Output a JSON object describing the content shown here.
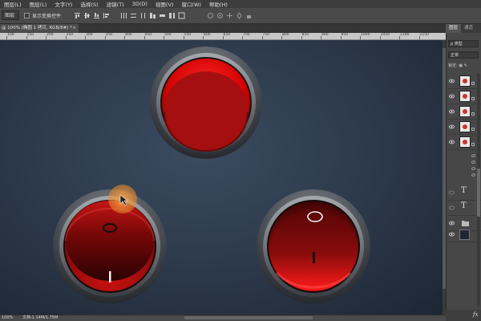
{
  "menu": [
    "图层(L)",
    "图层(L)",
    "文字(Y)",
    "选择(S)",
    "滤镜(T)",
    "3D(D)",
    "视图(V)",
    "窗口(W)",
    "帮助(H)"
  ],
  "options": {
    "select_value": "图层",
    "show_transform_label": "显示变换控件"
  },
  "document_tab": {
    "title": "@ 100% (椭圆 1 拷贝, RGB/8#) *",
    "close": "×"
  },
  "ruler_ticks": [
    "100",
    "150",
    "200",
    "250",
    "300",
    "350",
    "400",
    "450",
    "500",
    "550",
    "600",
    "650",
    "700",
    "750",
    "800",
    "850",
    "900",
    "950",
    "1000",
    "1050",
    "1100",
    "1150"
  ],
  "status": {
    "zoom": "100%",
    "doc": "文档:1.14M/1.75M"
  },
  "panel": {
    "tabs": [
      "图层",
      "通道"
    ],
    "kind_filter": "ρ 类型",
    "blend_mode": "正常",
    "lock_label": "锁定: ▣ ✎",
    "text_layer_glyph": "T",
    "fx_label": "fx"
  },
  "buttons": [
    {
      "position": "top",
      "state": "pressed",
      "has_power_symbol": false
    },
    {
      "position": "bottom-left",
      "state": "off",
      "symbols": [
        "O",
        "I"
      ]
    },
    {
      "position": "bottom-right",
      "state": "on",
      "symbols": [
        "O",
        "I"
      ]
    }
  ],
  "colors": {
    "accent_red": "#e00000",
    "canvas_bg": "#2b3849",
    "cursor_highlight": "#f39a3c"
  }
}
